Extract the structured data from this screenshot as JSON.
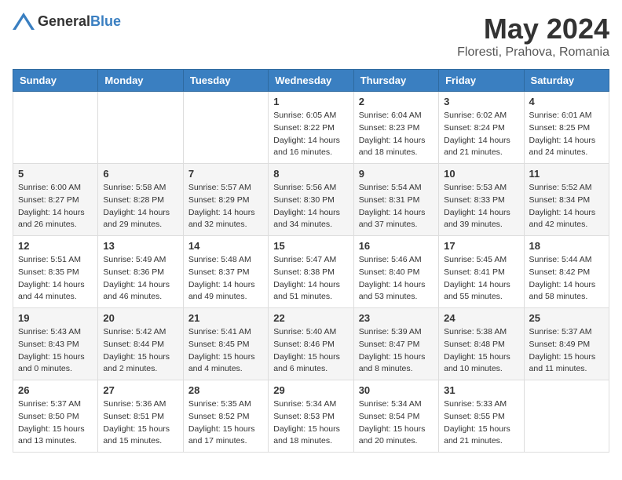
{
  "header": {
    "logo_general": "General",
    "logo_blue": "Blue",
    "month_title": "May 2024",
    "location": "Floresti, Prahova, Romania"
  },
  "weekdays": [
    "Sunday",
    "Monday",
    "Tuesday",
    "Wednesday",
    "Thursday",
    "Friday",
    "Saturday"
  ],
  "weeks": [
    [
      {
        "day": "",
        "info": ""
      },
      {
        "day": "",
        "info": ""
      },
      {
        "day": "",
        "info": ""
      },
      {
        "day": "1",
        "info": "Sunrise: 6:05 AM\nSunset: 8:22 PM\nDaylight: 14 hours\nand 16 minutes."
      },
      {
        "day": "2",
        "info": "Sunrise: 6:04 AM\nSunset: 8:23 PM\nDaylight: 14 hours\nand 18 minutes."
      },
      {
        "day": "3",
        "info": "Sunrise: 6:02 AM\nSunset: 8:24 PM\nDaylight: 14 hours\nand 21 minutes."
      },
      {
        "day": "4",
        "info": "Sunrise: 6:01 AM\nSunset: 8:25 PM\nDaylight: 14 hours\nand 24 minutes."
      }
    ],
    [
      {
        "day": "5",
        "info": "Sunrise: 6:00 AM\nSunset: 8:27 PM\nDaylight: 14 hours\nand 26 minutes."
      },
      {
        "day": "6",
        "info": "Sunrise: 5:58 AM\nSunset: 8:28 PM\nDaylight: 14 hours\nand 29 minutes."
      },
      {
        "day": "7",
        "info": "Sunrise: 5:57 AM\nSunset: 8:29 PM\nDaylight: 14 hours\nand 32 minutes."
      },
      {
        "day": "8",
        "info": "Sunrise: 5:56 AM\nSunset: 8:30 PM\nDaylight: 14 hours\nand 34 minutes."
      },
      {
        "day": "9",
        "info": "Sunrise: 5:54 AM\nSunset: 8:31 PM\nDaylight: 14 hours\nand 37 minutes."
      },
      {
        "day": "10",
        "info": "Sunrise: 5:53 AM\nSunset: 8:33 PM\nDaylight: 14 hours\nand 39 minutes."
      },
      {
        "day": "11",
        "info": "Sunrise: 5:52 AM\nSunset: 8:34 PM\nDaylight: 14 hours\nand 42 minutes."
      }
    ],
    [
      {
        "day": "12",
        "info": "Sunrise: 5:51 AM\nSunset: 8:35 PM\nDaylight: 14 hours\nand 44 minutes."
      },
      {
        "day": "13",
        "info": "Sunrise: 5:49 AM\nSunset: 8:36 PM\nDaylight: 14 hours\nand 46 minutes."
      },
      {
        "day": "14",
        "info": "Sunrise: 5:48 AM\nSunset: 8:37 PM\nDaylight: 14 hours\nand 49 minutes."
      },
      {
        "day": "15",
        "info": "Sunrise: 5:47 AM\nSunset: 8:38 PM\nDaylight: 14 hours\nand 51 minutes."
      },
      {
        "day": "16",
        "info": "Sunrise: 5:46 AM\nSunset: 8:40 PM\nDaylight: 14 hours\nand 53 minutes."
      },
      {
        "day": "17",
        "info": "Sunrise: 5:45 AM\nSunset: 8:41 PM\nDaylight: 14 hours\nand 55 minutes."
      },
      {
        "day": "18",
        "info": "Sunrise: 5:44 AM\nSunset: 8:42 PM\nDaylight: 14 hours\nand 58 minutes."
      }
    ],
    [
      {
        "day": "19",
        "info": "Sunrise: 5:43 AM\nSunset: 8:43 PM\nDaylight: 15 hours\nand 0 minutes."
      },
      {
        "day": "20",
        "info": "Sunrise: 5:42 AM\nSunset: 8:44 PM\nDaylight: 15 hours\nand 2 minutes."
      },
      {
        "day": "21",
        "info": "Sunrise: 5:41 AM\nSunset: 8:45 PM\nDaylight: 15 hours\nand 4 minutes."
      },
      {
        "day": "22",
        "info": "Sunrise: 5:40 AM\nSunset: 8:46 PM\nDaylight: 15 hours\nand 6 minutes."
      },
      {
        "day": "23",
        "info": "Sunrise: 5:39 AM\nSunset: 8:47 PM\nDaylight: 15 hours\nand 8 minutes."
      },
      {
        "day": "24",
        "info": "Sunrise: 5:38 AM\nSunset: 8:48 PM\nDaylight: 15 hours\nand 10 minutes."
      },
      {
        "day": "25",
        "info": "Sunrise: 5:37 AM\nSunset: 8:49 PM\nDaylight: 15 hours\nand 11 minutes."
      }
    ],
    [
      {
        "day": "26",
        "info": "Sunrise: 5:37 AM\nSunset: 8:50 PM\nDaylight: 15 hours\nand 13 minutes."
      },
      {
        "day": "27",
        "info": "Sunrise: 5:36 AM\nSunset: 8:51 PM\nDaylight: 15 hours\nand 15 minutes."
      },
      {
        "day": "28",
        "info": "Sunrise: 5:35 AM\nSunset: 8:52 PM\nDaylight: 15 hours\nand 17 minutes."
      },
      {
        "day": "29",
        "info": "Sunrise: 5:34 AM\nSunset: 8:53 PM\nDaylight: 15 hours\nand 18 minutes."
      },
      {
        "day": "30",
        "info": "Sunrise: 5:34 AM\nSunset: 8:54 PM\nDaylight: 15 hours\nand 20 minutes."
      },
      {
        "day": "31",
        "info": "Sunrise: 5:33 AM\nSunset: 8:55 PM\nDaylight: 15 hours\nand 21 minutes."
      },
      {
        "day": "",
        "info": ""
      }
    ]
  ]
}
